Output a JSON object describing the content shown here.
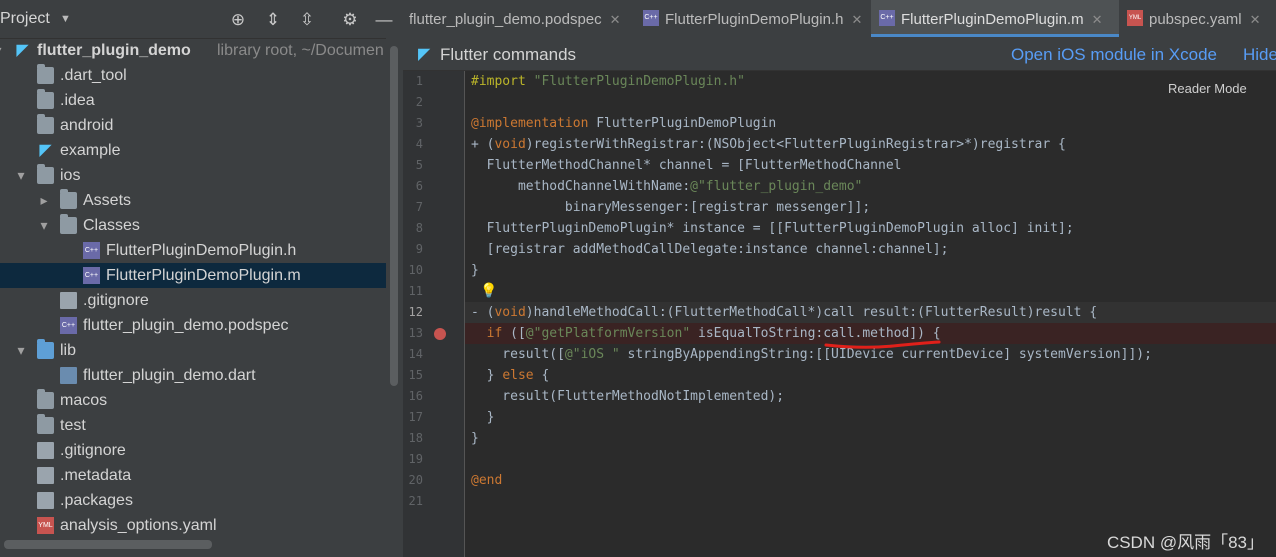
{
  "project_panel": {
    "title": "Project",
    "tree": [
      {
        "label": "flutter_plugin_demo",
        "hint": "library root,  ~/Documen",
        "indent": 0,
        "arrow": "down",
        "icon": "flutter"
      },
      {
        "label": ".dart_tool",
        "indent": 1,
        "icon": "folder"
      },
      {
        "label": ".idea",
        "indent": 1,
        "icon": "folder"
      },
      {
        "label": "android",
        "indent": 1,
        "icon": "folder"
      },
      {
        "label": "example",
        "indent": 1,
        "icon": "flutter"
      },
      {
        "label": "ios",
        "indent": 1,
        "arrow": "down",
        "icon": "folder"
      },
      {
        "label": "Assets",
        "indent": 2,
        "arrow": "right",
        "icon": "folder"
      },
      {
        "label": "Classes",
        "indent": 2,
        "arrow": "down",
        "icon": "folder"
      },
      {
        "label": "FlutterPluginDemoPlugin.h",
        "indent": 3,
        "icon": "cpp"
      },
      {
        "label": "FlutterPluginDemoPlugin.m",
        "indent": 3,
        "icon": "cpp",
        "selected": true
      },
      {
        "label": ".gitignore",
        "indent": 2,
        "icon": "file"
      },
      {
        "label": "flutter_plugin_demo.podspec",
        "indent": 2,
        "icon": "cpp"
      },
      {
        "label": "lib",
        "indent": 1,
        "arrow": "down",
        "icon": "folder-blue"
      },
      {
        "label": "flutter_plugin_demo.dart",
        "indent": 2,
        "icon": "dart"
      },
      {
        "label": "macos",
        "indent": 1,
        "icon": "folder"
      },
      {
        "label": "test",
        "indent": 1,
        "icon": "folder"
      },
      {
        "label": ".gitignore",
        "indent": 1,
        "icon": "file"
      },
      {
        "label": ".metadata",
        "indent": 1,
        "icon": "file"
      },
      {
        "label": ".packages",
        "indent": 1,
        "icon": "file"
      },
      {
        "label": "analysis_options.yaml",
        "indent": 1,
        "icon": "yml"
      }
    ]
  },
  "tabs": [
    {
      "label": "flutter_plugin_demo.podspec",
      "icon": "none"
    },
    {
      "label": "FlutterPluginDemoPlugin.h",
      "icon": "cpp"
    },
    {
      "label": "FlutterPluginDemoPlugin.m",
      "icon": "cpp",
      "active": true
    },
    {
      "label": "pubspec.yaml",
      "icon": "yml"
    }
  ],
  "banner": {
    "title": "Flutter commands",
    "open_ios": "Open iOS module in Xcode",
    "hide": "Hide"
  },
  "editor": {
    "reader_mode": "Reader Mode",
    "current_line": 12,
    "breakpoint_line": 13,
    "lines": [
      {
        "n": "1",
        "t": "#import \"FlutterPluginDemoPlugin.h\""
      },
      {
        "n": "2",
        "t": ""
      },
      {
        "n": "3",
        "t": "@implementation FlutterPluginDemoPlugin"
      },
      {
        "n": "4",
        "t": "+ (void)registerWithRegistrar:(NSObject<FlutterPluginRegistrar>*)registrar {"
      },
      {
        "n": "5",
        "t": "  FlutterMethodChannel* channel = [FlutterMethodChannel"
      },
      {
        "n": "6",
        "t": "      methodChannelWithName:@\"flutter_plugin_demo\""
      },
      {
        "n": "7",
        "t": "            binaryMessenger:[registrar messenger]];"
      },
      {
        "n": "8",
        "t": "  FlutterPluginDemoPlugin* instance = [[FlutterPluginDemoPlugin alloc] init];"
      },
      {
        "n": "9",
        "t": "  [registrar addMethodCallDelegate:instance channel:channel];"
      },
      {
        "n": "10",
        "t": "}"
      },
      {
        "n": "11",
        "t": ""
      },
      {
        "n": "12",
        "t": "- (void)handleMethodCall:(FlutterMethodCall*)call result:(FlutterResult)result {"
      },
      {
        "n": "13",
        "t": "  if ([@\"getPlatformVersion\" isEqualToString:call.method]) {"
      },
      {
        "n": "14",
        "t": "    result([@\"iOS \" stringByAppendingString:[[UIDevice currentDevice] systemVersion]]);"
      },
      {
        "n": "15",
        "t": "  } else {"
      },
      {
        "n": "16",
        "t": "    result(FlutterMethodNotImplemented);"
      },
      {
        "n": "17",
        "t": "  }"
      },
      {
        "n": "18",
        "t": "}"
      },
      {
        "n": "19",
        "t": ""
      },
      {
        "n": "20",
        "t": "@end"
      },
      {
        "n": "21",
        "t": ""
      }
    ]
  },
  "watermark": "CSDN @风雨「83」",
  "colors": {
    "keyword": "#cc7832",
    "string": "#6a8759",
    "directive": "#bbb529",
    "accent": "#4a88c7",
    "selection": "#0d293e"
  }
}
